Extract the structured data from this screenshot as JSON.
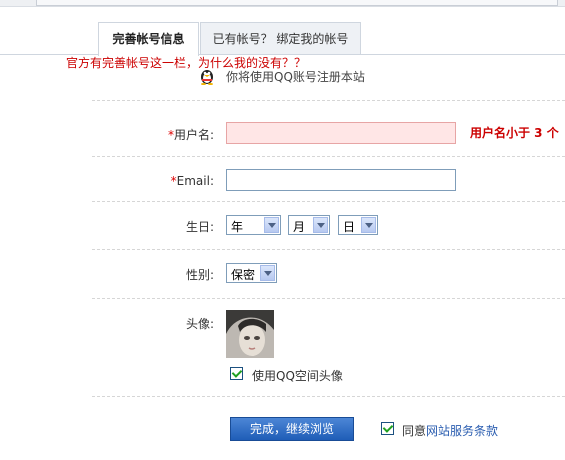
{
  "tabs": [
    {
      "label": "完善帐号信息",
      "active": true
    },
    {
      "label": "已有帐号？ 绑定我的帐号",
      "active": false
    }
  ],
  "complaint_text": "官方有完善帐号这一栏，为什么我的没有？？",
  "qq_notice": "你将使用QQ账号注册本站",
  "form": {
    "required_mark": "*",
    "username": {
      "label": "用户名:",
      "value": "",
      "error": "用户名小于 3 个"
    },
    "email": {
      "label": "Email:",
      "value": ""
    },
    "birthday": {
      "label": "生日:",
      "year": "年",
      "month": "月",
      "day": "日"
    },
    "gender": {
      "label": "性别:",
      "value": "保密"
    },
    "avatar": {
      "label": "头像:",
      "use_qq_avatar": "使用QQ空间头像",
      "checked": true
    }
  },
  "submit_label": "完成，继续浏览",
  "terms": {
    "prefix": "同意",
    "link": "网站服务条款",
    "checked": true
  },
  "colors": {
    "accent": "#1f5db7",
    "error": "#cc0000",
    "error_bg": "#ffe6e6"
  }
}
